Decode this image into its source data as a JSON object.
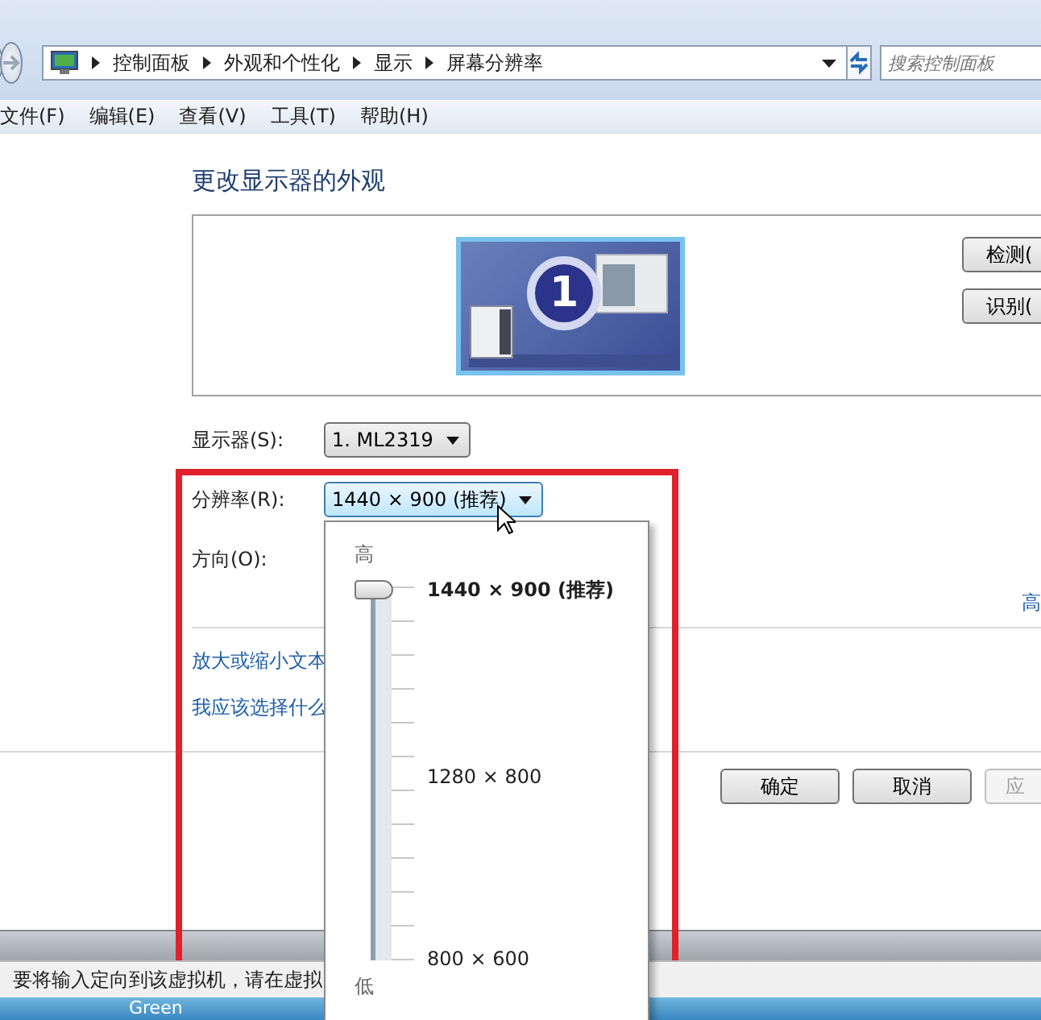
{
  "address_bar": {
    "crumbs": [
      "控制面板",
      "外观和个性化",
      "显示",
      "屏幕分辨率"
    ]
  },
  "search": {
    "placeholder": "搜索控制面板"
  },
  "menu": [
    "文件(F)",
    "编辑(E)",
    "查看(V)",
    "工具(T)",
    "帮助(H)"
  ],
  "heading": "更改显示器的外观",
  "monitor_preview": {
    "number": "1"
  },
  "preview_buttons": [
    "检测(",
    "识别("
  ],
  "fields": [
    {
      "label": "显示器(S):",
      "value": "1. ML2319",
      "open": false
    },
    {
      "label": "分辨率(R):",
      "value": "1440 × 900 (推荐)",
      "open": true
    },
    {
      "label": "方向(O):"
    }
  ],
  "advanced_link": "高",
  "links": [
    "放大或缩小文本",
    "我应该选择什么"
  ],
  "dialog_buttons": [
    {
      "label": "确定",
      "disabled": false
    },
    {
      "label": "取消",
      "disabled": false
    },
    {
      "label": "应",
      "disabled": true
    }
  ],
  "resolution_popup": {
    "high": "高",
    "low": "低",
    "level": 1,
    "marks": [
      {
        "label": "1440 × 900 (推荐)",
        "selected": true
      },
      {
        "label": "1280 × 800",
        "selected": false
      },
      {
        "label": "800 × 600",
        "selected": false
      }
    ]
  },
  "vm_status": "要将输入定向到该虚拟机，请在虚拟",
  "taskbar_text": "Green"
}
